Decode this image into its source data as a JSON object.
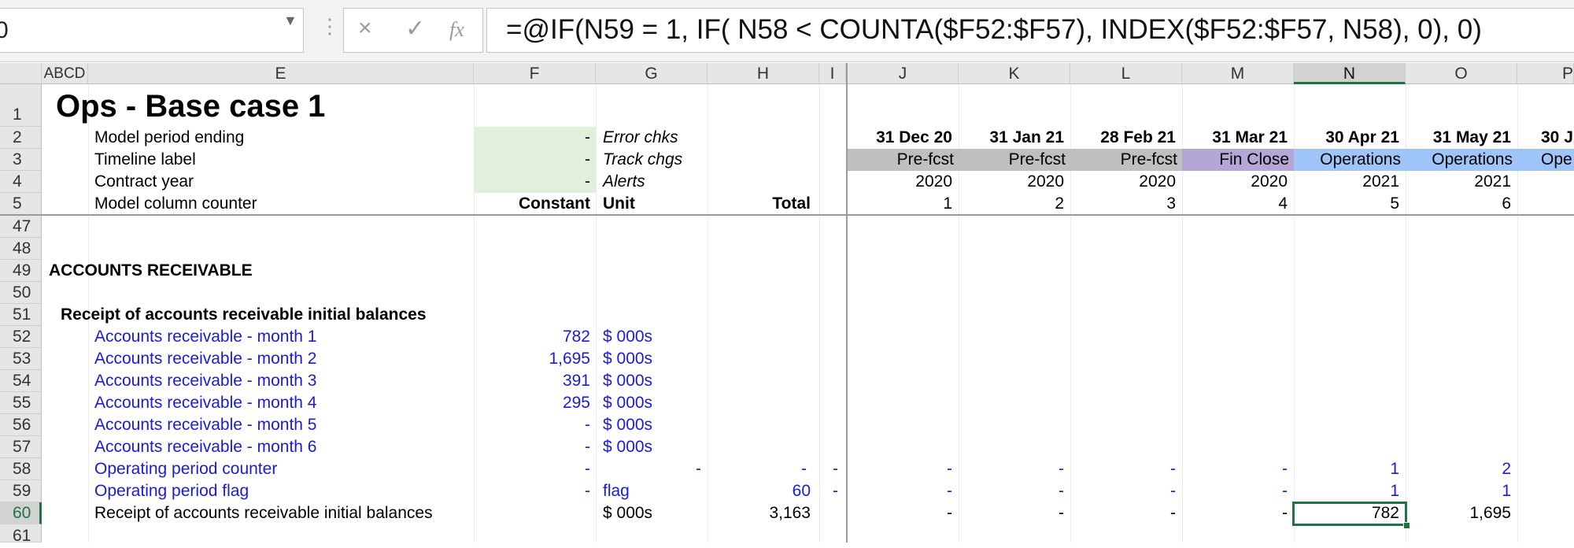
{
  "formula_bar": {
    "name_box": "0",
    "cancel_icon": "×",
    "enter_icon": "✓",
    "fx_icon": "fx",
    "formula": "=@IF(N59 = 1,  IF( N58 < COUNTA($F52:$F57), INDEX($F52:$F57, N58), 0), 0)"
  },
  "columns": [
    {
      "label": "ABCD"
    },
    {
      "label": "E"
    },
    {
      "label": "F"
    },
    {
      "label": "G"
    },
    {
      "label": "H"
    },
    {
      "label": "I"
    },
    {
      "label": "J"
    },
    {
      "label": "K"
    },
    {
      "label": "L"
    },
    {
      "label": "M"
    },
    {
      "label": "N"
    },
    {
      "label": "O"
    },
    {
      "label": "P"
    }
  ],
  "rows": [
    "1",
    "2",
    "3",
    "4",
    "5",
    "47",
    "48",
    "49",
    "50",
    "51",
    "52",
    "53",
    "54",
    "55",
    "56",
    "57",
    "58",
    "59",
    "60",
    "61"
  ],
  "title": "Ops - Base case 1",
  "header_labels": {
    "r2": "Model period ending",
    "r3": "Timeline label",
    "r4": "Contract year",
    "r5": "Model column counter",
    "f2": "-",
    "f3": "-",
    "f4": "-",
    "f5": "Constant",
    "g2": "Error chks",
    "g3": "Track chgs",
    "g4": "Alerts",
    "g5": "Unit",
    "h5": "Total"
  },
  "timeline": {
    "dates": [
      "31 Dec 20",
      "31 Jan 21",
      "28 Feb 21",
      "31 Mar 21",
      "30 Apr 21",
      "31 May 21",
      "30 J"
    ],
    "labels": [
      "Pre-fcst",
      "Pre-fcst",
      "Pre-fcst",
      "Fin Close",
      "Operations",
      "Operations",
      "Ope"
    ],
    "years": [
      "2020",
      "2020",
      "2020",
      "2020",
      "2021",
      "2021"
    ],
    "counters": [
      "1",
      "2",
      "3",
      "4",
      "5",
      "6"
    ]
  },
  "section": {
    "heading": "ACCOUNTS RECEIVABLE",
    "subheading": "Receipt of accounts receivable initial balances",
    "lines": [
      {
        "label": "Accounts receivable - month 1",
        "f": "782",
        "g": "$ 000s"
      },
      {
        "label": "Accounts receivable - month 2",
        "f": "1,695",
        "g": "$ 000s"
      },
      {
        "label": "Accounts receivable - month 3",
        "f": "391",
        "g": "$ 000s"
      },
      {
        "label": "Accounts receivable - month 4",
        "f": "295",
        "g": "$ 000s"
      },
      {
        "label": "Accounts receivable - month 5",
        "f": "-",
        "g": "$ 000s"
      },
      {
        "label": "Accounts receivable - month 6",
        "f": "-",
        "g": "$ 000s"
      }
    ],
    "counter_row": {
      "label": "Operating period counter",
      "f": "-",
      "g": "-",
      "h": "-",
      "i": "-",
      "t": [
        "-",
        "-",
        "-",
        "-",
        "1",
        "2"
      ]
    },
    "flag_row": {
      "label": "Operating period flag",
      "f": "-",
      "g": "flag",
      "h": "60",
      "i": "-",
      "t": [
        "-",
        "-",
        "-",
        "-",
        "1",
        "1"
      ]
    },
    "receipt_row": {
      "label": "Receipt of accounts receivable initial balances",
      "g": "$ 000s",
      "h": "3,163",
      "t": [
        "-",
        "-",
        "-",
        "-",
        "782",
        "1,695"
      ]
    }
  },
  "colors": {
    "header_grey": "#e6e6e6",
    "selection_green": "#217346",
    "input_blue": "#1a1ad8",
    "prefcst_grey": "#bfbfbf",
    "finclose_purple": "#b4a7d6",
    "operations_blue": "#9fc5f8",
    "input_green": "#e2efda"
  }
}
